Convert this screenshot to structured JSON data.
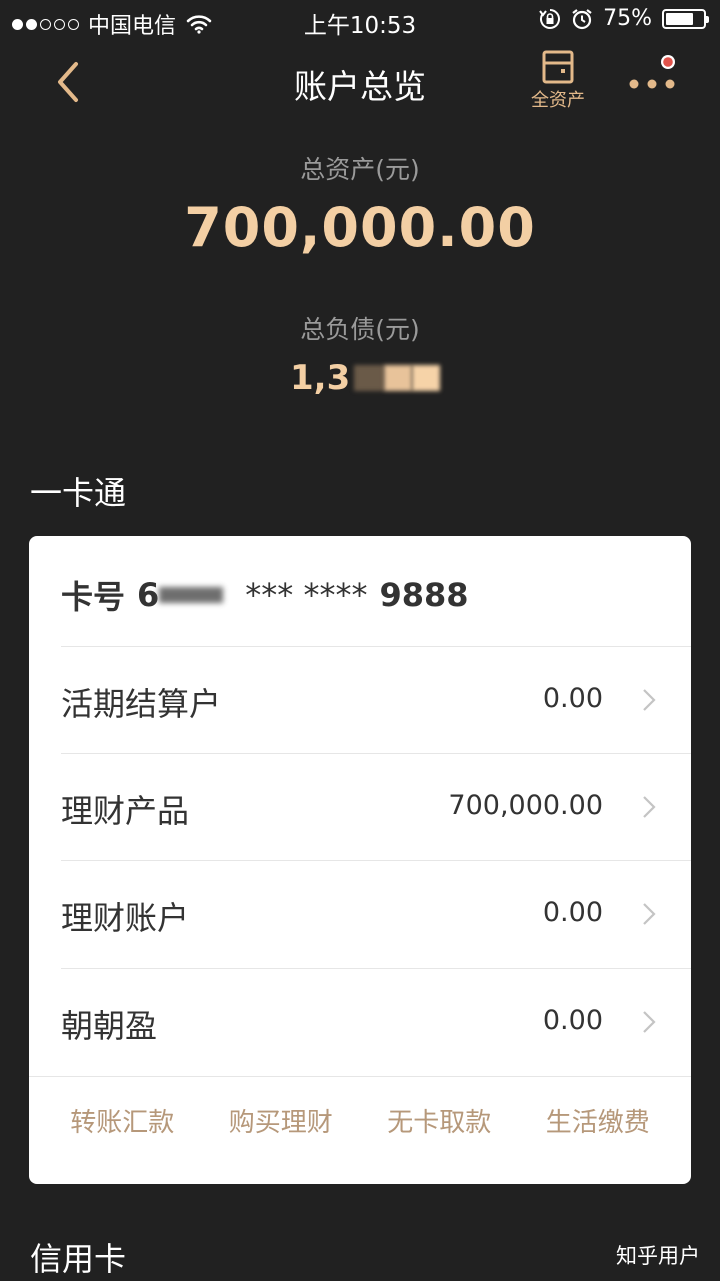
{
  "status_bar": {
    "carrier": "中国电信",
    "time": "上午10:53",
    "battery_text": "75%",
    "battery_level": 0.75,
    "signal_bars_filled": 2,
    "signal_bars_total": 5
  },
  "nav": {
    "title": "账户总览",
    "all_assets_label": "全资产",
    "more_has_badge": true
  },
  "summary": {
    "total_assets_label": "总资产(元)",
    "total_assets_value": "700,000.00",
    "total_liabilities_label": "总负债(元)",
    "total_liabilities_visible": "1,3"
  },
  "one_card": {
    "section_title": "一卡通",
    "card_number_label": "卡号",
    "card_number_visible_prefix": "6",
    "card_number_masked": "*** ****",
    "card_number_suffix": "9888",
    "rows": [
      {
        "label": "活期结算户",
        "value": "0.00"
      },
      {
        "label": "理财产品",
        "value": "700,000.00"
      },
      {
        "label": "理财账户",
        "value": "0.00"
      },
      {
        "label": "朝朝盈",
        "value": "0.00"
      }
    ],
    "actions": [
      "转账汇款",
      "购买理财",
      "无卡取款",
      "生活缴费"
    ]
  },
  "credit_card": {
    "section_title": "信用卡"
  },
  "watermark": "知乎用户",
  "colors": {
    "background": "#212121",
    "accent_gold": "#f3cfa4",
    "icon_gold": "#e3b98a",
    "action_text": "#b6987a",
    "badge_red": "#e0524a"
  }
}
